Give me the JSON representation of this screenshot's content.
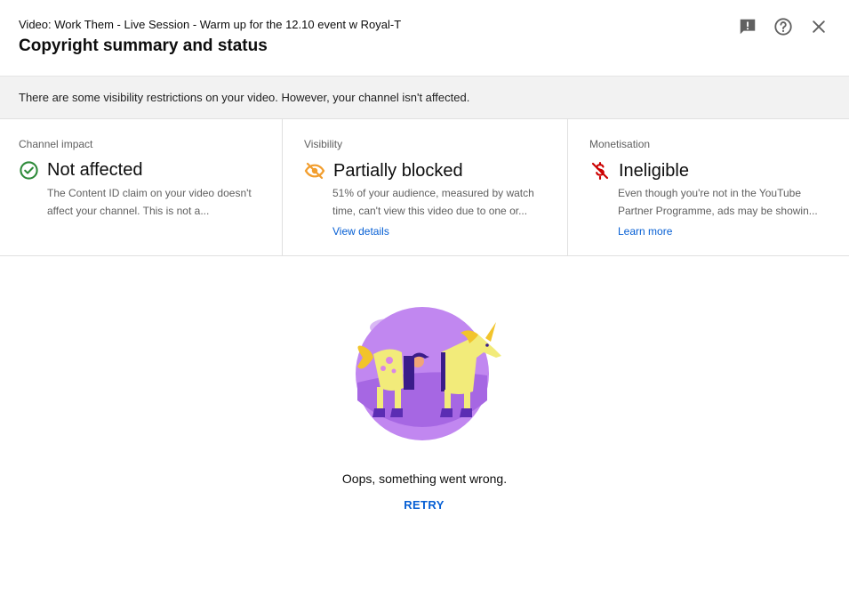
{
  "header": {
    "video_title": "Video: Work Them - Live Session - Warm up for the 12.10 event w Royal-T",
    "dialog_title": "Copyright summary and status",
    "actions": [
      {
        "icon": "feedback-icon"
      },
      {
        "icon": "help-icon"
      },
      {
        "icon": "close-icon"
      }
    ]
  },
  "banner": {
    "text": "There are some visibility restrictions on your video. However, your channel isn't affected."
  },
  "cards": [
    {
      "label": "Channel impact",
      "status": "Not affected",
      "icon": "check-circle-icon",
      "icon_color": "#2e8b3a",
      "desc_line1": "The Content ID claim on your video doesn't",
      "desc_line2": "affect your channel. This is not a..."
    },
    {
      "label": "Visibility",
      "status": "Partially blocked",
      "icon": "eye-off-icon",
      "icon_color": "#f29e2e",
      "desc_line1": "51% of your audience, measured by watch",
      "desc_line2": "time, can't view this video due to one or...",
      "link": "View details"
    },
    {
      "label": "Monetisation",
      "status": "Ineligible",
      "icon": "money-off-icon",
      "icon_color": "#cc0000",
      "desc_line1": "Even though you're not in the YouTube",
      "desc_line2": "Partner Programme, ads may be showin...",
      "link": "Learn more"
    }
  ],
  "error": {
    "illustration": "unicorn-costume-illustration",
    "message": "Oops, something went wrong.",
    "retry_label": "RETRY"
  },
  "colors": {
    "link": "#065fd4",
    "banner_bg": "#f2f2f2",
    "illustration_purple": "#c187f0"
  }
}
